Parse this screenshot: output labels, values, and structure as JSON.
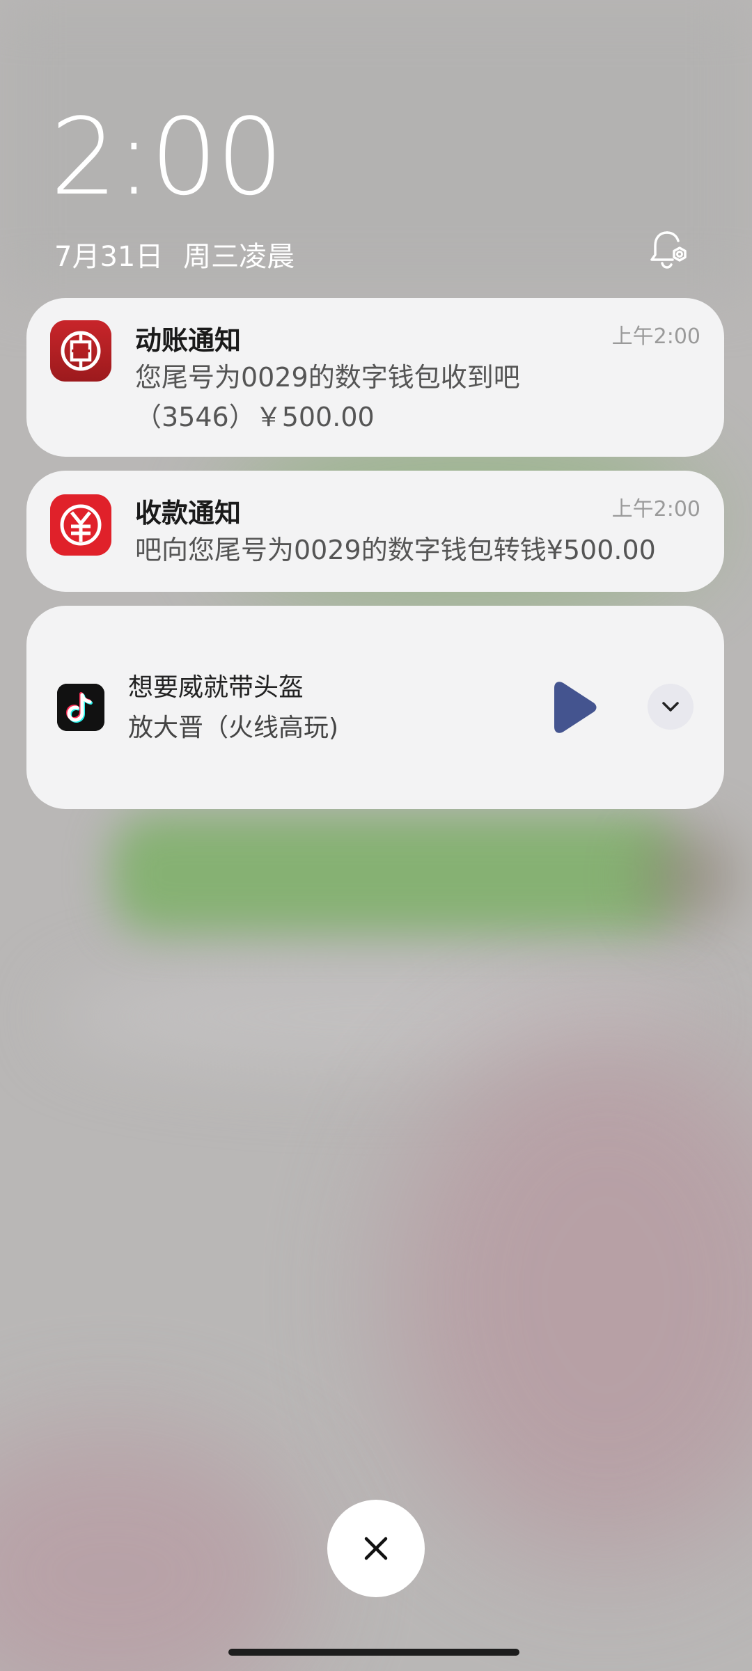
{
  "lockscreen": {
    "time": "2:00",
    "date": "7月31日",
    "weekday_period": "周三凌晨"
  },
  "notifications": [
    {
      "app_icon": "bank-logo-icon",
      "title": "动账通知",
      "time": "上午2:00",
      "body": "您尾号为0029的数字钱包收到吧（3546）￥500.00",
      "icon_color": "#b41f22"
    },
    {
      "app_icon": "digital-yuan-icon",
      "title": "收款通知",
      "time": "上午2:00",
      "body": "吧向您尾号为0029的数字钱包转钱¥500.00",
      "icon_color": "#e0212a"
    }
  ],
  "media": {
    "app_icon": "tiktok-icon",
    "song_title": "想要威就带头盔",
    "artist": "放大晋（火线高玩)",
    "play_icon": "play-icon",
    "expand_icon": "chevron-down-icon",
    "play_color": "#44548f"
  },
  "controls": {
    "close_icon": "close-icon",
    "settings_icon": "notification-settings-icon"
  }
}
